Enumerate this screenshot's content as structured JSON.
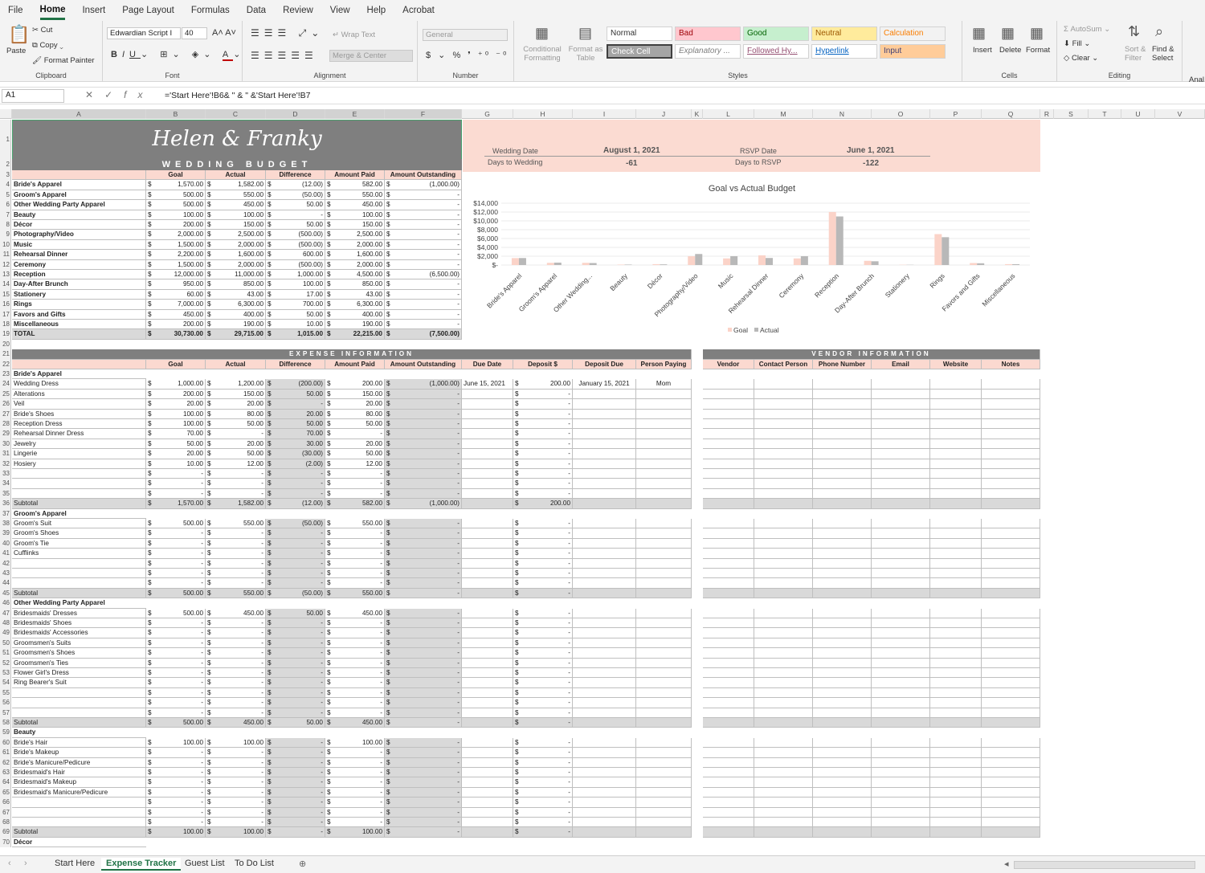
{
  "menu": [
    "File",
    "Home",
    "Insert",
    "Page Layout",
    "Formulas",
    "Data",
    "Review",
    "View",
    "Help",
    "Acrobat"
  ],
  "menu_active": 1,
  "ribbon": {
    "clipboard": {
      "paste": "Paste",
      "cut": "Cut",
      "copy": "Copy",
      "painter": "Format Painter",
      "label": "Clipboard"
    },
    "font": {
      "family": "Edwardian Script I",
      "size": "40",
      "label": "Font"
    },
    "alignment": {
      "wrap": "Wrap Text",
      "merge": "Merge & Center",
      "label": "Alignment"
    },
    "number": {
      "format": "General",
      "label": "Number"
    },
    "styles": {
      "cond": "Conditional Formatting",
      "table": "Format as Table",
      "label": "Styles",
      "cells": [
        {
          "name": "Normal",
          "bg": "#ffffff",
          "color": "#333333"
        },
        {
          "name": "Bad",
          "bg": "#ffc7ce",
          "color": "#9c0006"
        },
        {
          "name": "Good",
          "bg": "#c6efce",
          "color": "#006100"
        },
        {
          "name": "Neutral",
          "bg": "#ffeb9c",
          "color": "#9c5700"
        },
        {
          "name": "Calculation",
          "bg": "#f2f2f2",
          "color": "#fa7d00"
        },
        {
          "name": "Check Cell",
          "bg": "#a5a5a5",
          "color": "#ffffff"
        },
        {
          "name": "Explanatory ...",
          "bg": "#ffffff",
          "color": "#7f7f7f"
        },
        {
          "name": "Followed Hy...",
          "bg": "#ffffff",
          "color": "#954f72"
        },
        {
          "name": "Hyperlink",
          "bg": "#ffffff",
          "color": "#0563c1"
        },
        {
          "name": "Input",
          "bg": "#ffcc99",
          "color": "#3f3f76"
        }
      ]
    },
    "cells": {
      "insert": "Insert",
      "delete": "Delete",
      "format": "Format",
      "label": "Cells"
    },
    "editing": {
      "autosum": "AutoSum",
      "fill": "Fill",
      "clear": "Clear",
      "sort": "Sort & Filter",
      "find": "Find & Select",
      "label": "Editing"
    },
    "analysis": "Anal"
  },
  "formula_bar": {
    "cell": "A1",
    "formula": "='Start Here'!B6& \" & \" &'Start Here'!B7"
  },
  "columns": [
    "A",
    "B",
    "C",
    "D",
    "E",
    "F",
    "G",
    "H",
    "I",
    "J",
    "K",
    "L",
    "M",
    "N",
    "O",
    "P",
    "Q",
    "R",
    "S",
    "T",
    "U",
    "V"
  ],
  "title": {
    "names": "Helen & Franky",
    "budget": "WEDDING BUDGET"
  },
  "dates": {
    "wedding_label": "Wedding Date",
    "wedding": "August 1, 2021",
    "days_wedding_label": "Days to Wedding",
    "days_wedding": "-61",
    "rsvp_label": "RSVP Date",
    "rsvp": "June 1, 2021",
    "days_rsvp_label": "Days to RSVP",
    "days_rsvp": "-122"
  },
  "summary_headers": [
    "Goal",
    "Actual",
    "Difference",
    "Amount Paid",
    "Amount Outstanding"
  ],
  "summary_rows": [
    [
      "Bride's Apparel",
      "1,570.00",
      "1,582.00",
      "(12.00)",
      "582.00",
      "(1,000.00)"
    ],
    [
      "Groom's Apparel",
      "500.00",
      "550.00",
      "(50.00)",
      "550.00",
      "-"
    ],
    [
      "Other Wedding Party Apparel",
      "500.00",
      "450.00",
      "50.00",
      "450.00",
      "-"
    ],
    [
      "Beauty",
      "100.00",
      "100.00",
      "-",
      "100.00",
      "-"
    ],
    [
      "Décor",
      "200.00",
      "150.00",
      "50.00",
      "150.00",
      "-"
    ],
    [
      "Photography/Video",
      "2,000.00",
      "2,500.00",
      "(500.00)",
      "2,500.00",
      "-"
    ],
    [
      "Music",
      "1,500.00",
      "2,000.00",
      "(500.00)",
      "2,000.00",
      "-"
    ],
    [
      "Rehearsal Dinner",
      "2,200.00",
      "1,600.00",
      "600.00",
      "1,600.00",
      "-"
    ],
    [
      "Ceremony",
      "1,500.00",
      "2,000.00",
      "(500.00)",
      "2,000.00",
      "-"
    ],
    [
      "Reception",
      "12,000.00",
      "11,000.00",
      "1,000.00",
      "4,500.00",
      "(6,500.00)"
    ],
    [
      "Day-After Brunch",
      "950.00",
      "850.00",
      "100.00",
      "850.00",
      "-"
    ],
    [
      "Stationery",
      "60.00",
      "43.00",
      "17.00",
      "43.00",
      "-"
    ],
    [
      "Rings",
      "7,000.00",
      "6,300.00",
      "700.00",
      "6,300.00",
      "-"
    ],
    [
      "Favors and Gifts",
      "450.00",
      "400.00",
      "50.00",
      "400.00",
      "-"
    ],
    [
      "Miscellaneous",
      "200.00",
      "190.00",
      "10.00",
      "190.00",
      "-"
    ]
  ],
  "summary_total": [
    "TOTAL",
    "30,730.00",
    "29,715.00",
    "1,015.00",
    "22,215.00",
    "(7,500.00)"
  ],
  "expense_title": "EXPENSE INFORMATION",
  "vendor_title": "VENDOR INFORMATION",
  "expense_headers": [
    "Goal",
    "Actual",
    "Difference",
    "Amount Paid",
    "Amount Outstanding",
    "Due Date",
    "Deposit $",
    "Deposit Due",
    "Person Paying"
  ],
  "vendor_headers": [
    "Vendor",
    "Contact Person",
    "Phone Number",
    "Email",
    "Website",
    "Notes"
  ],
  "sections": [
    {
      "name": "Bride's Apparel",
      "items": [
        [
          "Wedding Dress",
          "1,000.00",
          "1,200.00",
          "(200.00)",
          "200.00",
          "(1,000.00)",
          "June 15, 2021",
          "200.00",
          "January 15, 2021",
          "Mom"
        ],
        [
          "Alterations",
          "200.00",
          "150.00",
          "50.00",
          "150.00",
          "-",
          "",
          "-",
          "",
          ""
        ],
        [
          "Veil",
          "20.00",
          "20.00",
          "-",
          "20.00",
          "-",
          "",
          "-",
          "",
          ""
        ],
        [
          "Bride's Shoes",
          "100.00",
          "80.00",
          "20.00",
          "80.00",
          "-",
          "",
          "-",
          "",
          ""
        ],
        [
          "Reception Dress",
          "100.00",
          "50.00",
          "50.00",
          "50.00",
          "-",
          "",
          "-",
          "",
          ""
        ],
        [
          "Rehearsal Dinner Dress",
          "70.00",
          "-",
          "70.00",
          "-",
          "-",
          "",
          "-",
          "",
          ""
        ],
        [
          "Jewelry",
          "50.00",
          "20.00",
          "30.00",
          "20.00",
          "-",
          "",
          "-",
          "",
          ""
        ],
        [
          "Lingerie",
          "20.00",
          "50.00",
          "(30.00)",
          "50.00",
          "-",
          "",
          "-",
          "",
          ""
        ],
        [
          "Hosiery",
          "10.00",
          "12.00",
          "(2.00)",
          "12.00",
          "-",
          "",
          "-",
          "",
          ""
        ],
        [
          "",
          "-",
          "-",
          "-",
          "-",
          "-",
          "",
          "-",
          "",
          ""
        ],
        [
          "",
          "-",
          "-",
          "-",
          "-",
          "-",
          "",
          "-",
          "",
          ""
        ],
        [
          "",
          "-",
          "-",
          "-",
          "-",
          "-",
          "",
          "-",
          "",
          ""
        ]
      ],
      "subtotal": [
        "Subtotal",
        "1,570.00",
        "1,582.00",
        "(12.00)",
        "582.00",
        "(1,000.00)",
        "",
        "200.00"
      ]
    },
    {
      "name": "Groom's Apparel",
      "items": [
        [
          "Groom's Suit",
          "500.00",
          "550.00",
          "(50.00)",
          "550.00",
          "-",
          "",
          "-",
          "",
          ""
        ],
        [
          "Groom's Shoes",
          "-",
          "-",
          "-",
          "-",
          "-",
          "",
          "-",
          "",
          ""
        ],
        [
          "Groom's Tie",
          "-",
          "-",
          "-",
          "-",
          "-",
          "",
          "-",
          "",
          ""
        ],
        [
          "Cufflinks",
          "-",
          "-",
          "-",
          "-",
          "-",
          "",
          "-",
          "",
          ""
        ],
        [
          "",
          "-",
          "-",
          "-",
          "-",
          "-",
          "",
          "-",
          "",
          ""
        ],
        [
          "",
          "-",
          "-",
          "-",
          "-",
          "-",
          "",
          "-",
          "",
          ""
        ],
        [
          "",
          "-",
          "-",
          "-",
          "-",
          "-",
          "",
          "-",
          "",
          ""
        ]
      ],
      "subtotal": [
        "Subtotal",
        "500.00",
        "550.00",
        "(50.00)",
        "550.00",
        "-",
        "",
        "-"
      ]
    },
    {
      "name": "Other Wedding Party Apparel",
      "items": [
        [
          "Bridesmaids' Dresses",
          "500.00",
          "450.00",
          "50.00",
          "450.00",
          "-",
          "",
          "-",
          "",
          ""
        ],
        [
          "Bridesmaids' Shoes",
          "-",
          "-",
          "-",
          "-",
          "-",
          "",
          "-",
          "",
          ""
        ],
        [
          "Bridesmaids' Accessories",
          "-",
          "-",
          "-",
          "-",
          "-",
          "",
          "-",
          "",
          ""
        ],
        [
          "Groomsmen's Suits",
          "-",
          "-",
          "-",
          "-",
          "-",
          "",
          "-",
          "",
          ""
        ],
        [
          "Groomsmen's Shoes",
          "-",
          "-",
          "-",
          "-",
          "-",
          "",
          "-",
          "",
          ""
        ],
        [
          "Groomsmen's Ties",
          "-",
          "-",
          "-",
          "-",
          "-",
          "",
          "-",
          "",
          ""
        ],
        [
          "Flower Girl's Dress",
          "-",
          "-",
          "-",
          "-",
          "-",
          "",
          "-",
          "",
          ""
        ],
        [
          "Ring Bearer's Suit",
          "-",
          "-",
          "-",
          "-",
          "-",
          "",
          "-",
          "",
          ""
        ],
        [
          "",
          "-",
          "-",
          "-",
          "-",
          "-",
          "",
          "-",
          "",
          ""
        ],
        [
          "",
          "-",
          "-",
          "-",
          "-",
          "-",
          "",
          "-",
          "",
          ""
        ],
        [
          "",
          "-",
          "-",
          "-",
          "-",
          "-",
          "",
          "-",
          "",
          ""
        ]
      ],
      "subtotal": [
        "Subtotal",
        "500.00",
        "450.00",
        "50.00",
        "450.00",
        "-",
        "",
        "-"
      ]
    },
    {
      "name": "Beauty",
      "items": [
        [
          "Bride's Hair",
          "100.00",
          "100.00",
          "-",
          "100.00",
          "-",
          "",
          "-",
          "",
          ""
        ],
        [
          "Bride's Makeup",
          "-",
          "-",
          "-",
          "-",
          "-",
          "",
          "-",
          "",
          ""
        ],
        [
          "Bride's Manicure/Pedicure",
          "-",
          "-",
          "-",
          "-",
          "-",
          "",
          "-",
          "",
          ""
        ],
        [
          "Bridesmaid's Hair",
          "-",
          "-",
          "-",
          "-",
          "-",
          "",
          "-",
          "",
          ""
        ],
        [
          "Bridesmaid's Makeup",
          "-",
          "-",
          "-",
          "-",
          "-",
          "",
          "-",
          "",
          ""
        ],
        [
          "Bridesmaid's Manicure/Pedicure",
          "-",
          "-",
          "-",
          "-",
          "-",
          "",
          "-",
          "",
          ""
        ],
        [
          "",
          "-",
          "-",
          "-",
          "-",
          "-",
          "",
          "-",
          "",
          ""
        ],
        [
          "",
          "-",
          "-",
          "-",
          "-",
          "-",
          "",
          "-",
          "",
          ""
        ],
        [
          "",
          "-",
          "-",
          "-",
          "-",
          "-",
          "",
          "-",
          "",
          ""
        ]
      ],
      "subtotal": [
        "Subtotal",
        "100.00",
        "100.00",
        "-",
        "100.00",
        "-",
        "",
        "-"
      ]
    },
    {
      "name": "Décor",
      "items": [],
      "subtotal": null
    }
  ],
  "chart_data": {
    "type": "bar",
    "title": "Goal vs Actual Budget",
    "categories": [
      "Bride's Apparel",
      "Groom's Apparel",
      "Other Wedding...",
      "Beauty",
      "Décor",
      "Photography/Video",
      "Music",
      "Rehearsal Dinner",
      "Ceremony",
      "Reception",
      "Day-After Brunch",
      "Stationery",
      "Rings",
      "Favors and Gifts",
      "Miscellaneous"
    ],
    "series": [
      {
        "name": "Goal",
        "color": "#fbd3c8",
        "values": [
          1570,
          500,
          500,
          100,
          200,
          2000,
          1500,
          2200,
          1500,
          12000,
          950,
          60,
          7000,
          450,
          200
        ]
      },
      {
        "name": "Actual",
        "color": "#b8b8b8",
        "values": [
          1582,
          550,
          450,
          100,
          150,
          2500,
          2000,
          1600,
          2000,
          11000,
          850,
          43,
          6300,
          400,
          190
        ]
      }
    ],
    "y_ticks": [
      "$-",
      "$2,000",
      "$4,000",
      "$6,000",
      "$8,000",
      "$10,000",
      "$12,000",
      "$14,000"
    ],
    "ylim": [
      0,
      14000
    ],
    "legend": "bottom"
  },
  "tabs": [
    "Start Here",
    "Expense Tracker",
    "Guest List",
    "To Do List"
  ],
  "active_tab": 1
}
